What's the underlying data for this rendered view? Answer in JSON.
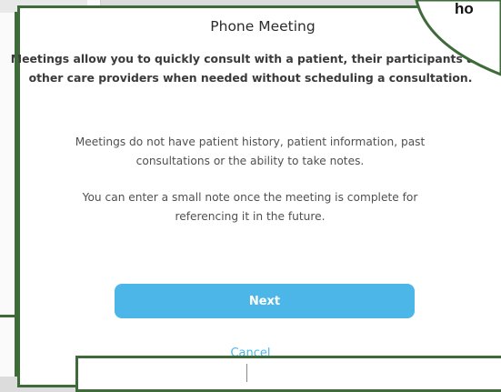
{
  "modal": {
    "title": "Phone Meeting",
    "lead": "Meetings allow you to quickly consult with a patient, their participants and other care providers when needed without scheduling a consultation.",
    "para1": "Meetings do not have patient history, patient information, past consultations or the ability to take notes.",
    "para2": "You can enter a small note once the meeting is complete for referencing it in the future.",
    "next_label": "Next",
    "cancel_label": "Cancel"
  },
  "callout": {
    "text": "ho"
  },
  "colors": {
    "accent": "#4db6e8",
    "frame": "#3f6b3a"
  }
}
